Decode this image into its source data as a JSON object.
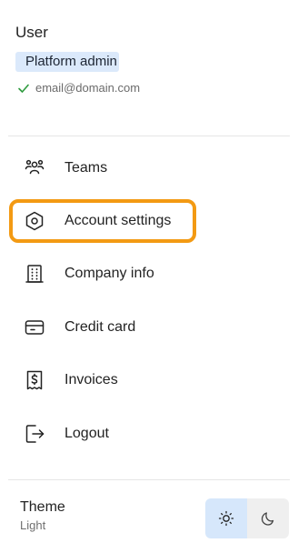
{
  "user": {
    "name": "User",
    "role": "Platform admin",
    "email": "email@domain.com",
    "verified_icon": "check-icon"
  },
  "menu": {
    "items": [
      {
        "label": "Teams",
        "icon": "users-icon"
      },
      {
        "label": "Account settings",
        "icon": "hexagon-settings-icon"
      },
      {
        "label": "Company info",
        "icon": "building-icon"
      },
      {
        "label": "Credit card",
        "icon": "credit-card-icon"
      },
      {
        "label": "Invoices",
        "icon": "receipt-dollar-icon"
      },
      {
        "label": "Logout",
        "icon": "logout-icon"
      }
    ],
    "highlighted": "Account settings",
    "highlight_color": "#f39a13"
  },
  "theme": {
    "title": "Theme",
    "value": "Light",
    "options": [
      "light",
      "dark"
    ],
    "selected": "light",
    "icons": [
      "sun-icon",
      "moon-icon"
    ]
  },
  "colors": {
    "badge_bg": "#dbe9fb",
    "check": "#2e9b3e",
    "toggle_selected": "#d6e7fb"
  }
}
